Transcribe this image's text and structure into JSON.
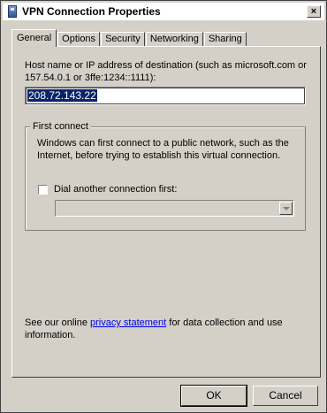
{
  "window": {
    "title": "VPN Connection Properties",
    "close_glyph": "×"
  },
  "tabs": [
    {
      "label": "General",
      "active": true
    },
    {
      "label": "Options",
      "active": false
    },
    {
      "label": "Security",
      "active": false
    },
    {
      "label": "Networking",
      "active": false
    },
    {
      "label": "Sharing",
      "active": false
    }
  ],
  "general": {
    "host_label": "Host name or IP address of destination (such as microsoft.com or 157.54.0.1 or 3ffe:1234::1111):",
    "host_value": "208.72.143.22",
    "first_connect": {
      "legend": "First connect",
      "description": "Windows can first connect to a public network, such as the Internet, before trying to establish this virtual connection.",
      "checkbox_label": "Dial another connection first:",
      "checkbox_checked": false,
      "combo_value": ""
    },
    "privacy": {
      "prefix": "See our online ",
      "link": "privacy statement",
      "suffix": " for data collection and use information."
    }
  },
  "buttons": {
    "ok": "OK",
    "cancel": "Cancel"
  },
  "icons": {
    "title": "vpn-connection-icon",
    "close": "close-icon"
  }
}
